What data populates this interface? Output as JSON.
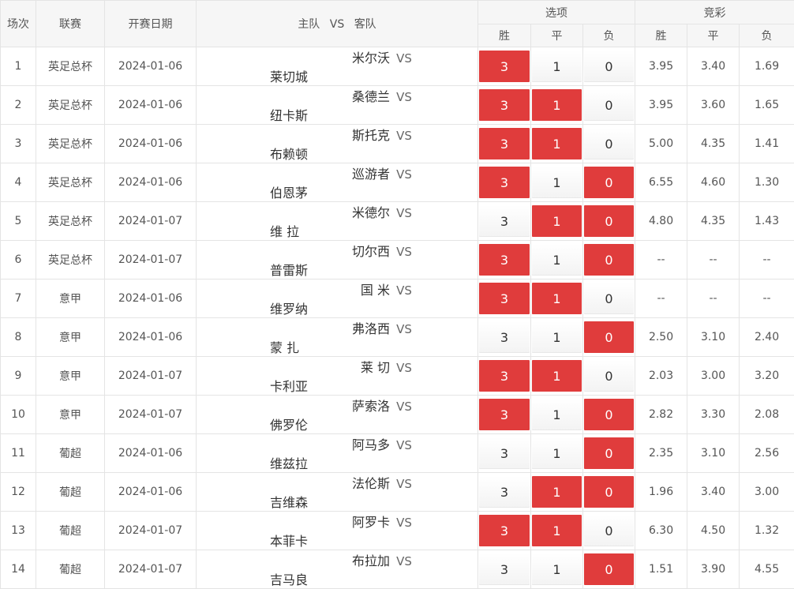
{
  "header": {
    "idx": "场次",
    "league": "联赛",
    "date": "开赛日期",
    "home": "主队",
    "vs": "VS",
    "away": "客队",
    "options": "选项",
    "lottery": "竞彩",
    "win": "胜",
    "draw": "平",
    "loss": "负"
  },
  "colors": {
    "selected": "#e03c3c",
    "header_bg": "#f6f6f6",
    "border": "#e4e4e4"
  },
  "rows": [
    {
      "idx": "1",
      "league": "英足总杯",
      "date": "2024-01-06",
      "home": "米尔沃",
      "away": "莱切城",
      "win": "3",
      "draw": "1",
      "loss": "0",
      "sel": [
        true,
        false,
        false
      ],
      "odds": [
        "3.95",
        "3.40",
        "1.69"
      ]
    },
    {
      "idx": "2",
      "league": "英足总杯",
      "date": "2024-01-06",
      "home": "桑德兰",
      "away": "纽卡斯",
      "win": "3",
      "draw": "1",
      "loss": "0",
      "sel": [
        true,
        true,
        false
      ],
      "odds": [
        "3.95",
        "3.60",
        "1.65"
      ]
    },
    {
      "idx": "3",
      "league": "英足总杯",
      "date": "2024-01-06",
      "home": "斯托克",
      "away": "布赖顿",
      "win": "3",
      "draw": "1",
      "loss": "0",
      "sel": [
        true,
        true,
        false
      ],
      "odds": [
        "5.00",
        "4.35",
        "1.41"
      ]
    },
    {
      "idx": "4",
      "league": "英足总杯",
      "date": "2024-01-06",
      "home": "巡游者",
      "away": "伯恩茅",
      "win": "3",
      "draw": "1",
      "loss": "0",
      "sel": [
        true,
        false,
        true
      ],
      "odds": [
        "6.55",
        "4.60",
        "1.30"
      ]
    },
    {
      "idx": "5",
      "league": "英足总杯",
      "date": "2024-01-07",
      "home": "米德尔",
      "away": "维 拉",
      "win": "3",
      "draw": "1",
      "loss": "0",
      "sel": [
        false,
        true,
        true
      ],
      "odds": [
        "4.80",
        "4.35",
        "1.43"
      ]
    },
    {
      "idx": "6",
      "league": "英足总杯",
      "date": "2024-01-07",
      "home": "切尔西",
      "away": "普雷斯",
      "win": "3",
      "draw": "1",
      "loss": "0",
      "sel": [
        true,
        false,
        true
      ],
      "odds": [
        "--",
        "--",
        "--"
      ]
    },
    {
      "idx": "7",
      "league": "意甲",
      "date": "2024-01-06",
      "home": "国 米",
      "away": "维罗纳",
      "win": "3",
      "draw": "1",
      "loss": "0",
      "sel": [
        true,
        true,
        false
      ],
      "odds": [
        "--",
        "--",
        "--"
      ]
    },
    {
      "idx": "8",
      "league": "意甲",
      "date": "2024-01-06",
      "home": "弗洛西",
      "away": "蒙 扎",
      "win": "3",
      "draw": "1",
      "loss": "0",
      "sel": [
        false,
        false,
        true
      ],
      "odds": [
        "2.50",
        "3.10",
        "2.40"
      ]
    },
    {
      "idx": "9",
      "league": "意甲",
      "date": "2024-01-07",
      "home": "莱 切",
      "away": "卡利亚",
      "win": "3",
      "draw": "1",
      "loss": "0",
      "sel": [
        true,
        true,
        false
      ],
      "odds": [
        "2.03",
        "3.00",
        "3.20"
      ]
    },
    {
      "idx": "10",
      "league": "意甲",
      "date": "2024-01-07",
      "home": "萨索洛",
      "away": "佛罗伦",
      "win": "3",
      "draw": "1",
      "loss": "0",
      "sel": [
        true,
        false,
        true
      ],
      "odds": [
        "2.82",
        "3.30",
        "2.08"
      ]
    },
    {
      "idx": "11",
      "league": "葡超",
      "date": "2024-01-06",
      "home": "阿马多",
      "away": "维兹拉",
      "win": "3",
      "draw": "1",
      "loss": "0",
      "sel": [
        false,
        false,
        true
      ],
      "odds": [
        "2.35",
        "3.10",
        "2.56"
      ]
    },
    {
      "idx": "12",
      "league": "葡超",
      "date": "2024-01-06",
      "home": "法伦斯",
      "away": "吉维森",
      "win": "3",
      "draw": "1",
      "loss": "0",
      "sel": [
        false,
        true,
        true
      ],
      "odds": [
        "1.96",
        "3.40",
        "3.00"
      ]
    },
    {
      "idx": "13",
      "league": "葡超",
      "date": "2024-01-07",
      "home": "阿罗卡",
      "away": "本菲卡",
      "win": "3",
      "draw": "1",
      "loss": "0",
      "sel": [
        true,
        true,
        false
      ],
      "odds": [
        "6.30",
        "4.50",
        "1.32"
      ]
    },
    {
      "idx": "14",
      "league": "葡超",
      "date": "2024-01-07",
      "home": "布拉加",
      "away": "吉马良",
      "win": "3",
      "draw": "1",
      "loss": "0",
      "sel": [
        false,
        false,
        true
      ],
      "odds": [
        "1.51",
        "3.90",
        "4.55"
      ]
    }
  ]
}
